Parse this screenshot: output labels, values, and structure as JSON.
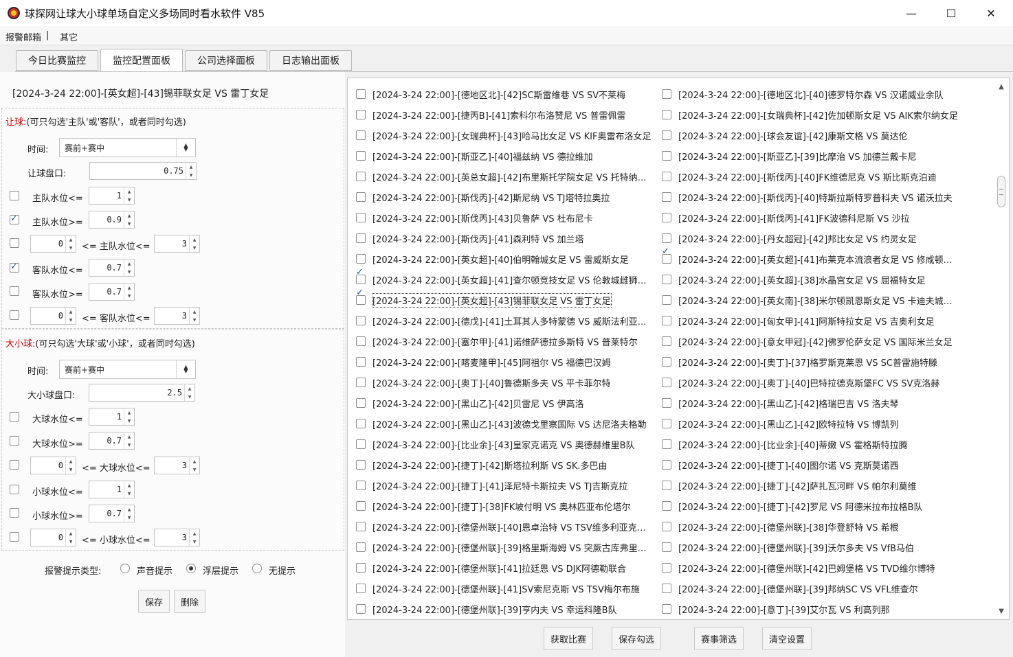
{
  "window": {
    "title": "球探网让球大小球单场自定义多场同时看水软件 V85",
    "minimize": "—",
    "maximize": "☐",
    "close": "✕"
  },
  "menu": [
    "报警邮箱",
    "|",
    "其它"
  ],
  "tabs": [
    "今日比赛监控",
    "监控配置面板",
    "公司选择面板",
    "日志输出面板"
  ],
  "active_tab": "监控配置面板",
  "selected_match": "[2024-3-24 22:00]-[英女超]-[43]锡菲联女足 VS 雷丁女足",
  "handicap": {
    "title": "让球:",
    "hint": "(可只勾选'主队'或'客队'，或者同时勾选)",
    "time_label": "时间:",
    "time_value": "赛前+赛中",
    "line_label": "让球盘口:",
    "line_value": "0.75",
    "rows": [
      {
        "checked": false,
        "label": "主队水位<=",
        "value": "1"
      },
      {
        "checked": true,
        "label": "主队水位>=",
        "value": "0.9"
      },
      {
        "checked": false,
        "low": "0",
        "mid": "<= 主队水位<=",
        "high": "3"
      },
      {
        "checked": true,
        "label": "客队水位<=",
        "value": "0.7"
      },
      {
        "checked": false,
        "label": "客队水位>=",
        "value": "0.7"
      },
      {
        "checked": false,
        "low": "0",
        "mid": "<= 客队水位<=",
        "high": "3"
      }
    ]
  },
  "overunder": {
    "title": "大小球:",
    "hint": "(可只勾选'大球'或'小球'，或者同时勾选)",
    "time_label": "时间:",
    "time_value": "赛前+赛中",
    "line_label": "大小球盘口:",
    "line_value": "2.5",
    "rows": [
      {
        "checked": false,
        "label": "大球水位<=",
        "value": "1"
      },
      {
        "checked": false,
        "label": "大球水位>=",
        "value": "0.7"
      },
      {
        "checked": false,
        "low": "0",
        "mid": "<= 大球水位<=",
        "high": "3"
      },
      {
        "checked": false,
        "label": "小球水位<=",
        "value": "1"
      },
      {
        "checked": false,
        "label": "小球水位>=",
        "value": "0.7"
      },
      {
        "checked": false,
        "low": "0",
        "mid": "<= 小球水位<=",
        "high": "3"
      }
    ]
  },
  "alert": {
    "label": "报警提示类型:",
    "options": [
      "声音提示",
      "浮层提示",
      "无提示"
    ],
    "selected": "浮层提示"
  },
  "left_buttons": {
    "save": "保存",
    "delete": "删除"
  },
  "bottom_buttons": [
    "获取比赛",
    "保存勾选",
    "赛事筛选",
    "清空设置"
  ],
  "matches_left": [
    {
      "checked": false,
      "text": "[2024-3-24 22:00]-[德地区北]-[42]SC斯雷维巷 VS SV不莱梅"
    },
    {
      "checked": false,
      "text": "[2024-3-24 22:00]-[捷丙B]-[41]索科尔布洛赞尼 VS 普雷佩雷"
    },
    {
      "checked": false,
      "text": "[2024-3-24 22:00]-[女瑞典杯]-[43]哈马比女足 VS KIF奥雷布洛女足"
    },
    {
      "checked": false,
      "text": "[2024-3-24 22:00]-[斯亚乙]-[40]福兹纳 VS 德拉维加"
    },
    {
      "checked": false,
      "text": "[2024-3-24 22:00]-[英总女超]-[42]布里斯托学院女足 VS 托特纳姆女足"
    },
    {
      "checked": false,
      "text": "[2024-3-24 22:00]-[斯伐丙]-[42]斯尼纳 VS TJ塔特拉奥拉"
    },
    {
      "checked": false,
      "text": "[2024-3-24 22:00]-[斯伐丙]-[43]贝鲁萨 VS 杜布尼卡"
    },
    {
      "checked": false,
      "text": "[2024-3-24 22:00]-[斯伐丙]-[41]森利特 VS 加兰塔"
    },
    {
      "checked": false,
      "text": "[2024-3-24 22:00]-[英女超]-[40]伯明翰城女足 VS 雷威斯女足"
    },
    {
      "checked": true,
      "text": "[2024-3-24 22:00]-[英女超]-[41]查尔顿竞技女足 VS 伦敦城雌狮女足"
    },
    {
      "checked": true,
      "text": "[2024-3-24 22:00]-[英女超]-[43]锡菲联女足 VS 雷丁女足",
      "focused": true
    },
    {
      "checked": false,
      "text": "[2024-3-24 22:00]-[德戊]-[41]土耳其人多特蒙德 VS 威斯法利亚赫尔内"
    },
    {
      "checked": false,
      "text": "[2024-3-24 22:00]-[塞尔甲]-[41]诺维萨德拉多斯特 VS 普莱特尔"
    },
    {
      "checked": false,
      "text": "[2024-3-24 22:00]-[喀麦隆甲]-[45]阿祖尔 VS 福德巴汉姆"
    },
    {
      "checked": false,
      "text": "[2024-3-24 22:00]-[奥丁]-[40]鲁德斯多夫 VS 平卡菲尔特"
    },
    {
      "checked": false,
      "text": "[2024-3-24 22:00]-[黑山乙]-[42]贝雷尼 VS 伊高洛"
    },
    {
      "checked": false,
      "text": "[2024-3-24 22:00]-[黑山乙]-[43]波德戈里察国际 VS 达尼洛夫格勒"
    },
    {
      "checked": false,
      "text": "[2024-3-24 22:00]-[比业余]-[43]皇家克诺克 VS 奥德赫维里B队"
    },
    {
      "checked": false,
      "text": "[2024-3-24 22:00]-[捷丁]-[42]斯塔拉利斯 VS SK.多巴由"
    },
    {
      "checked": false,
      "text": "[2024-3-24 22:00]-[捷丁]-[41]泽尼特卡斯拉夫 VS TJ吉斯克拉"
    },
    {
      "checked": false,
      "text": "[2024-3-24 22:00]-[捷丁]-[38]FK坡付明 VS 奥林匹亚布伦塔尔"
    },
    {
      "checked": false,
      "text": "[2024-3-24 22:00]-[德堡州联]-[40]恩卓治特 VS TSV维多利亚克鲁斯"
    },
    {
      "checked": false,
      "text": "[2024-3-24 22:00]-[德堡州联]-[39]格里斯海姆 VS 突厥古库弗里德堡"
    },
    {
      "checked": false,
      "text": "[2024-3-24 22:00]-[德堡州联]-[41]拉廷恩 VS DJK阿德勒联合"
    },
    {
      "checked": false,
      "text": "[2024-3-24 22:00]-[德堡州联]-[41]SV索尼克斯 VS TSV梅尔布施"
    },
    {
      "checked": false,
      "text": "[2024-3-24 22:00]-[德堡州联]-[39]亨内夫 VS 幸运科隆B队"
    }
  ],
  "matches_right": [
    {
      "checked": false,
      "text": "[2024-3-24 22:00]-[德地区北]-[40]德罗特尔森 VS 汉诺威业余队"
    },
    {
      "checked": false,
      "text": "[2024-3-24 22:00]-[女瑞典杯]-[42]佐加顿斯女足 VS AIK索尔纳女足"
    },
    {
      "checked": false,
      "text": "[2024-3-24 22:00]-[球会友谊]-[42]康斯文格 VS 莫达伦"
    },
    {
      "checked": false,
      "text": "[2024-3-24 22:00]-[斯亚乙]-[39]比摩治 VS 加德兰戴卡尼"
    },
    {
      "checked": false,
      "text": "[2024-3-24 22:00]-[斯伐丙]-[40]FK维德尼克 VS 斯比斯克泊迪"
    },
    {
      "checked": false,
      "text": "[2024-3-24 22:00]-[斯伐丙]-[40]特斯拉斯特罗普科夫 VS 诺沃拉夫"
    },
    {
      "checked": false,
      "text": "[2024-3-24 22:00]-[斯伐丙]-[41]FK波德科尼斯 VS 沙拉"
    },
    {
      "checked": false,
      "text": "[2024-3-24 22:00]-[丹女超冠]-[42]邦比女足 VS 约灵女足"
    },
    {
      "checked": true,
      "text": "[2024-3-24 22:00]-[英女超]-[41]布莱克本流浪者女足 VS 修咸顿女足"
    },
    {
      "checked": false,
      "text": "[2024-3-24 22:00]-[英女超]-[38]水晶宫女足 VS 屈福特女足"
    },
    {
      "checked": false,
      "text": "[2024-3-24 22:00]-[英女南]-[38]米尔顿凯恩斯女足 VS 卡迪夫城女足"
    },
    {
      "checked": false,
      "text": "[2024-3-24 22:00]-[匈女甲]-[41]阿斯特拉女足 VS 吉奥利女足"
    },
    {
      "checked": false,
      "text": "[2024-3-24 22:00]-[意女甲冠]-[42]佛罗伦萨女足 VS 国际米兰女足"
    },
    {
      "checked": false,
      "text": "[2024-3-24 22:00]-[奥丁]-[37]格罗斯克莱恩 VS SC普雷施特滕"
    },
    {
      "checked": false,
      "text": "[2024-3-24 22:00]-[奥丁]-[40]巴特拉德克斯堡FC VS SV克洛赫"
    },
    {
      "checked": false,
      "text": "[2024-3-24 22:00]-[黑山乙]-[42]格瑞巴吉 VS 洛夫琴"
    },
    {
      "checked": false,
      "text": "[2024-3-24 22:00]-[黑山乙]-[42]欧特拉特 VS 博凯列"
    },
    {
      "checked": false,
      "text": "[2024-3-24 22:00]-[比业余]-[40]蒂嫩 VS 霍格斯特拉腾"
    },
    {
      "checked": false,
      "text": "[2024-3-24 22:00]-[捷丁]-[40]图尔诺 VS 克斯莫诺西"
    },
    {
      "checked": false,
      "text": "[2024-3-24 22:00]-[捷丁]-[42]萨扎瓦河畔 VS 帕尔利莫维"
    },
    {
      "checked": false,
      "text": "[2024-3-24 22:00]-[捷丁]-[42]罗尼 VS 阿德米拉布拉格B队"
    },
    {
      "checked": false,
      "text": "[2024-3-24 22:00]-[德堡州联]-[38]华登舒特 VS 希根"
    },
    {
      "checked": false,
      "text": "[2024-3-24 22:00]-[德堡州联]-[39]沃尔多夫 VS VfB马伯"
    },
    {
      "checked": false,
      "text": "[2024-3-24 22:00]-[德堡州联]-[42]巴姆堡格 VS TVD维尔博特"
    },
    {
      "checked": false,
      "text": "[2024-3-24 22:00]-[德堡州联]-[39]邦纳SC VS VFL维查尔"
    },
    {
      "checked": false,
      "text": "[2024-3-24 22:00]-[意丁]-[39]艾尔瓦 VS 利高列那"
    }
  ],
  "scrollbar": {
    "up": "▲",
    "down": "▼"
  }
}
